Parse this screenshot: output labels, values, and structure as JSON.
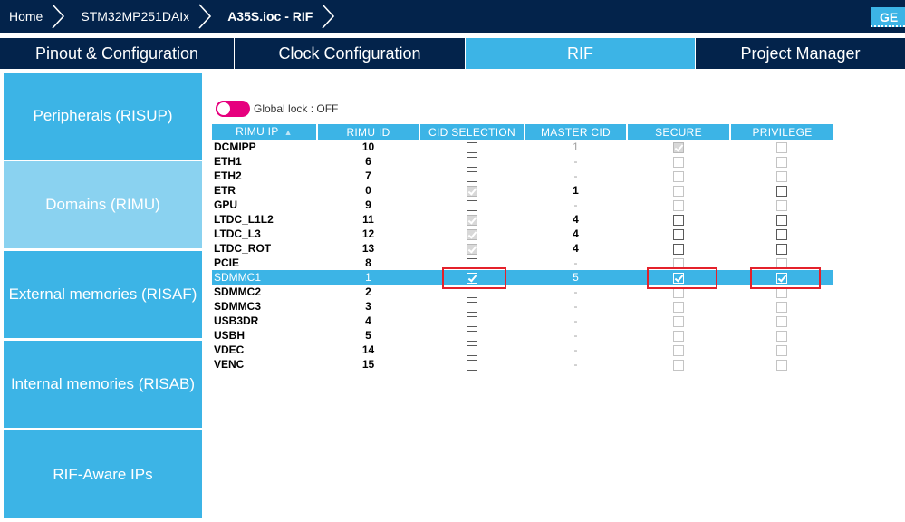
{
  "breadcrumb": {
    "items": [
      "Home",
      "STM32MP251DAIx",
      "A35S.ioc - RIF"
    ],
    "action_label": "GE"
  },
  "tabs": [
    {
      "label": "Pinout & Configuration",
      "active": false
    },
    {
      "label": "Clock Configuration",
      "active": false
    },
    {
      "label": "RIF",
      "active": true
    },
    {
      "label": "Project Manager",
      "active": false
    }
  ],
  "sidebar": {
    "items": [
      {
        "label": "Peripherals (RISUP)",
        "active": false
      },
      {
        "label": "Domains (RIMU)",
        "active": true
      },
      {
        "label": "External memories (RISAF)",
        "active": false
      },
      {
        "label": "Internal memories (RISAB)",
        "active": false
      },
      {
        "label": "RIF-Aware IPs",
        "active": false
      }
    ]
  },
  "global_lock": {
    "label": "Global lock : OFF",
    "state": "off",
    "color": "#e6007e"
  },
  "table": {
    "columns": [
      "RIMU IP",
      "RIMU ID",
      "CID SELECTION",
      "MASTER CID",
      "SECURE",
      "PRIVILEGE"
    ],
    "rows": [
      {
        "ip": "DCMIPP",
        "id": "10",
        "cid": {
          "checked": false,
          "enabled": true
        },
        "master": "1",
        "master_enabled": false,
        "secure": {
          "checked": true,
          "enabled": false
        },
        "priv": {
          "checked": false,
          "enabled": false
        },
        "selected": false
      },
      {
        "ip": "ETH1",
        "id": "6",
        "cid": {
          "checked": false,
          "enabled": true
        },
        "master": "-",
        "master_enabled": false,
        "secure": {
          "checked": false,
          "enabled": false
        },
        "priv": {
          "checked": false,
          "enabled": false
        },
        "selected": false
      },
      {
        "ip": "ETH2",
        "id": "7",
        "cid": {
          "checked": false,
          "enabled": true
        },
        "master": "-",
        "master_enabled": false,
        "secure": {
          "checked": false,
          "enabled": false
        },
        "priv": {
          "checked": false,
          "enabled": false
        },
        "selected": false
      },
      {
        "ip": "ETR",
        "id": "0",
        "cid": {
          "checked": true,
          "enabled": false
        },
        "master": "1",
        "master_enabled": true,
        "secure": {
          "checked": false,
          "enabled": false
        },
        "priv": {
          "checked": false,
          "enabled": true
        },
        "selected": false
      },
      {
        "ip": "GPU",
        "id": "9",
        "cid": {
          "checked": false,
          "enabled": true
        },
        "master": "-",
        "master_enabled": false,
        "secure": {
          "checked": false,
          "enabled": false
        },
        "priv": {
          "checked": false,
          "enabled": false
        },
        "selected": false
      },
      {
        "ip": "LTDC_L1L2",
        "id": "11",
        "cid": {
          "checked": true,
          "enabled": false
        },
        "master": "4",
        "master_enabled": true,
        "secure": {
          "checked": false,
          "enabled": true
        },
        "priv": {
          "checked": false,
          "enabled": true
        },
        "selected": false
      },
      {
        "ip": "LTDC_L3",
        "id": "12",
        "cid": {
          "checked": true,
          "enabled": false
        },
        "master": "4",
        "master_enabled": true,
        "secure": {
          "checked": false,
          "enabled": true
        },
        "priv": {
          "checked": false,
          "enabled": true
        },
        "selected": false
      },
      {
        "ip": "LTDC_ROT",
        "id": "13",
        "cid": {
          "checked": true,
          "enabled": false
        },
        "master": "4",
        "master_enabled": true,
        "secure": {
          "checked": false,
          "enabled": true
        },
        "priv": {
          "checked": false,
          "enabled": true
        },
        "selected": false
      },
      {
        "ip": "PCIE",
        "id": "8",
        "cid": {
          "checked": false,
          "enabled": true
        },
        "master": "-",
        "master_enabled": false,
        "secure": {
          "checked": false,
          "enabled": false
        },
        "priv": {
          "checked": false,
          "enabled": false
        },
        "selected": false
      },
      {
        "ip": "SDMMC1",
        "id": "1",
        "cid": {
          "checked": true,
          "enabled": true
        },
        "master": "5",
        "master_enabled": true,
        "secure": {
          "checked": true,
          "enabled": true
        },
        "priv": {
          "checked": true,
          "enabled": true
        },
        "selected": true
      },
      {
        "ip": "SDMMC2",
        "id": "2",
        "cid": {
          "checked": false,
          "enabled": true
        },
        "master": "-",
        "master_enabled": false,
        "secure": {
          "checked": false,
          "enabled": false
        },
        "priv": {
          "checked": false,
          "enabled": false
        },
        "selected": false
      },
      {
        "ip": "SDMMC3",
        "id": "3",
        "cid": {
          "checked": false,
          "enabled": true
        },
        "master": "-",
        "master_enabled": false,
        "secure": {
          "checked": false,
          "enabled": false
        },
        "priv": {
          "checked": false,
          "enabled": false
        },
        "selected": false
      },
      {
        "ip": "USB3DR",
        "id": "4",
        "cid": {
          "checked": false,
          "enabled": true
        },
        "master": "-",
        "master_enabled": false,
        "secure": {
          "checked": false,
          "enabled": false
        },
        "priv": {
          "checked": false,
          "enabled": false
        },
        "selected": false
      },
      {
        "ip": "USBH",
        "id": "5",
        "cid": {
          "checked": false,
          "enabled": true
        },
        "master": "-",
        "master_enabled": false,
        "secure": {
          "checked": false,
          "enabled": false
        },
        "priv": {
          "checked": false,
          "enabled": false
        },
        "selected": false
      },
      {
        "ip": "VDEC",
        "id": "14",
        "cid": {
          "checked": false,
          "enabled": true
        },
        "master": "-",
        "master_enabled": false,
        "secure": {
          "checked": false,
          "enabled": false
        },
        "priv": {
          "checked": false,
          "enabled": false
        },
        "selected": false
      },
      {
        "ip": "VENC",
        "id": "15",
        "cid": {
          "checked": false,
          "enabled": true
        },
        "master": "-",
        "master_enabled": false,
        "secure": {
          "checked": false,
          "enabled": false
        },
        "priv": {
          "checked": false,
          "enabled": false
        },
        "selected": false
      }
    ]
  },
  "colors": {
    "navy": "#03234b",
    "accent": "#3cb4e6",
    "sidebar_active": "#8ad2f0",
    "highlight_box": "#e4212b"
  },
  "icons": {
    "breadcrumb_separator": "chevron-right-icon",
    "sort": "sort-ascending-icon"
  }
}
